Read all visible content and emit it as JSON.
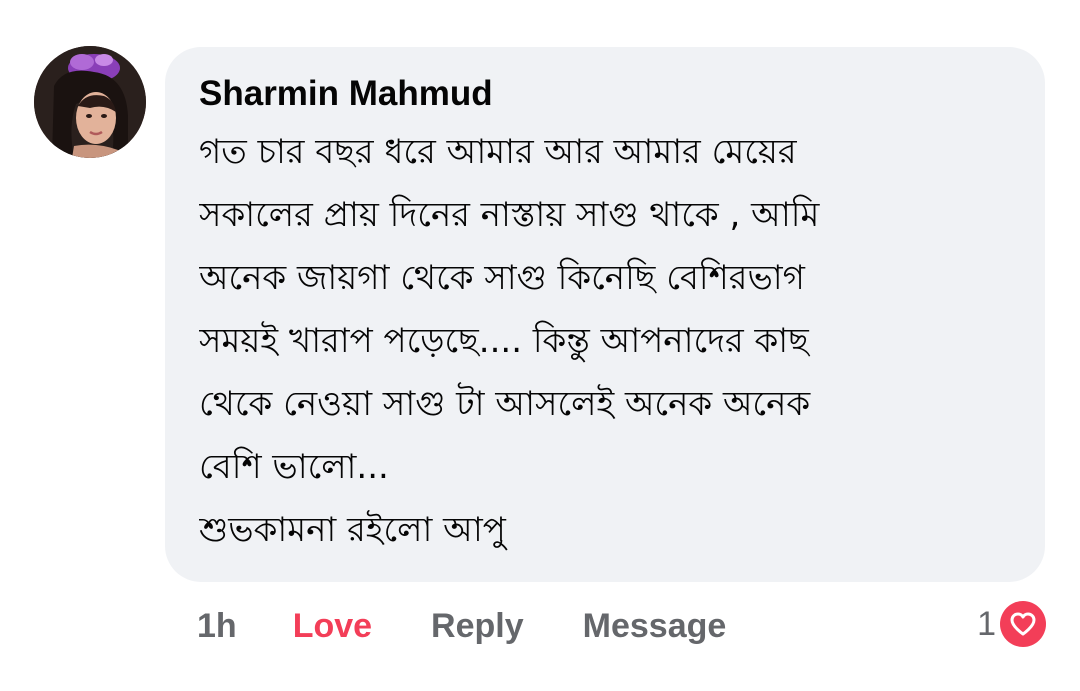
{
  "comment": {
    "author": "Sharmin Mahmud",
    "lines": [
      "গত চার বছর ধরে আমার আর আমার মেয়ের",
      "সকালের প্রায় দিনের নাস্তায় সাগু থাকে , আমি",
      "অনেক জায়গা থেকে সাগু কিনেছি বেশিরভাগ",
      "সময়ই খারাপ পড়েছে.... কিন্তু আপনাদের কাছ",
      "থেকে নেওয়া সাগু টা আসলেই অনেক অনেক",
      "বেশি ভালো...",
      "শুভকামনা রইলো আপু"
    ]
  },
  "actions": {
    "time": "1h",
    "love_label": "Love",
    "reply_label": "Reply",
    "message_label": "Message"
  },
  "reactions": {
    "count": "1",
    "icon": "heart-icon",
    "color": "#f33e58"
  },
  "colors": {
    "bubble": "#f0f2f5",
    "text": "#050505",
    "muted": "#65676b",
    "love": "#f33e58"
  }
}
